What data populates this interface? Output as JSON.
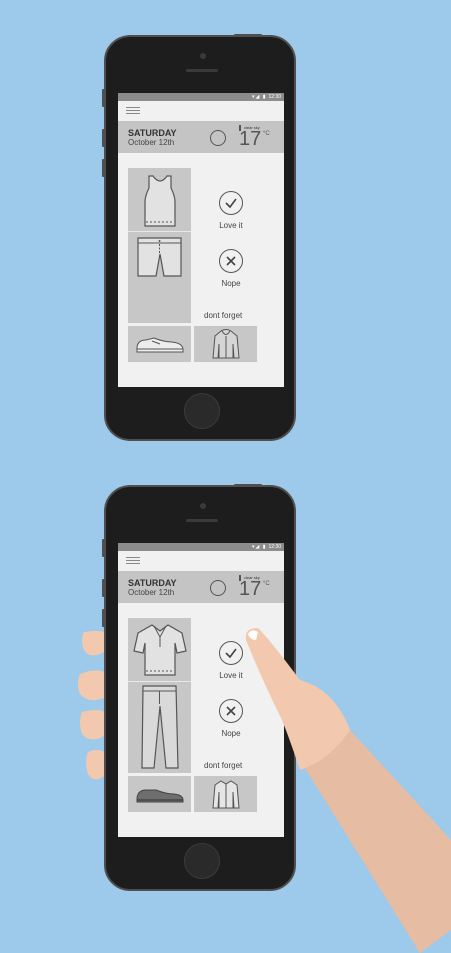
{
  "status": {
    "icons": "▾◢ ▮",
    "time": "12:30"
  },
  "screens": [
    {
      "day": "SATURDAY",
      "date": "October 12th",
      "weather_desc": "clear sky",
      "temperature": "17",
      "unit": "°C",
      "love_label": "Love it",
      "nope_label": "Nope",
      "dont_forget": "dont forget",
      "outfit": [
        "tank-top",
        "shorts",
        "sneaker",
        "hoodie"
      ]
    },
    {
      "day": "SATURDAY",
      "date": "October 12th",
      "weather_desc": "clear sky",
      "temperature": "17",
      "unit": "°C",
      "love_label": "Love it",
      "nope_label": "Nope",
      "dont_forget": "dont forget",
      "outfit": [
        "polo-shirt",
        "trousers",
        "dress-shoe",
        "shirt-jacket"
      ]
    }
  ],
  "colors": {
    "background": "#9dc9ea",
    "skin": "#f2c9ae",
    "sleeve": "#e6bca2"
  }
}
